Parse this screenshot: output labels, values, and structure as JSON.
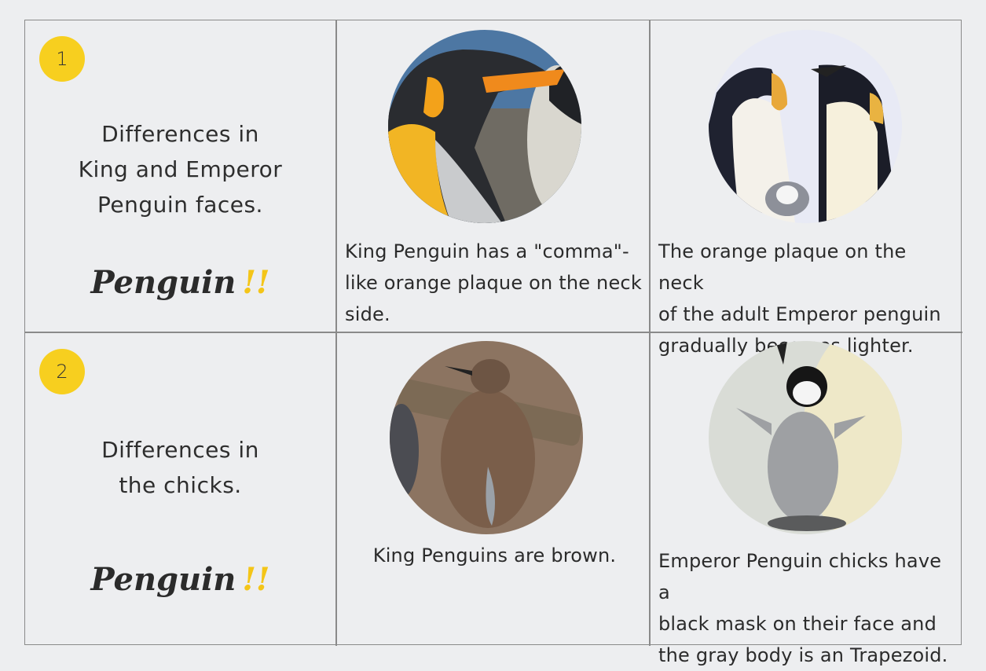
{
  "rows": [
    {
      "number": "1",
      "title_lines": [
        "Differences in",
        "King and Emperor",
        "Penguin faces."
      ],
      "brand": "Penguin",
      "brand_mark": "!!",
      "king": {
        "photo": "king-penguin-adult-face",
        "caption_lines": [
          "King Penguin has a \"comma\"-",
          "like orange plaque on the neck",
          "side."
        ]
      },
      "emperor": {
        "photo": "emperor-penguin-adults-with-chick",
        "caption_lines": [
          "The orange plaque on the neck",
          "of the adult Emperor penguin",
          "gradually becomes lighter."
        ]
      }
    },
    {
      "number": "2",
      "title_lines": [
        "Differences in",
        "the chicks."
      ],
      "brand": "Penguin",
      "brand_mark": "!!",
      "king": {
        "photo": "king-penguin-brown-chick",
        "caption_lines": [
          "King Penguins are brown."
        ]
      },
      "emperor": {
        "photo": "emperor-penguin-gray-chick",
        "caption_lines": [
          "Emperor Penguin chicks have a",
          "black mask on their face and",
          "the gray body is an Trapezoid."
        ]
      }
    }
  ],
  "colors": {
    "accent_yellow": "#f7cf1f",
    "background": "#edeef0",
    "grid_line": "#8a8a8a"
  }
}
